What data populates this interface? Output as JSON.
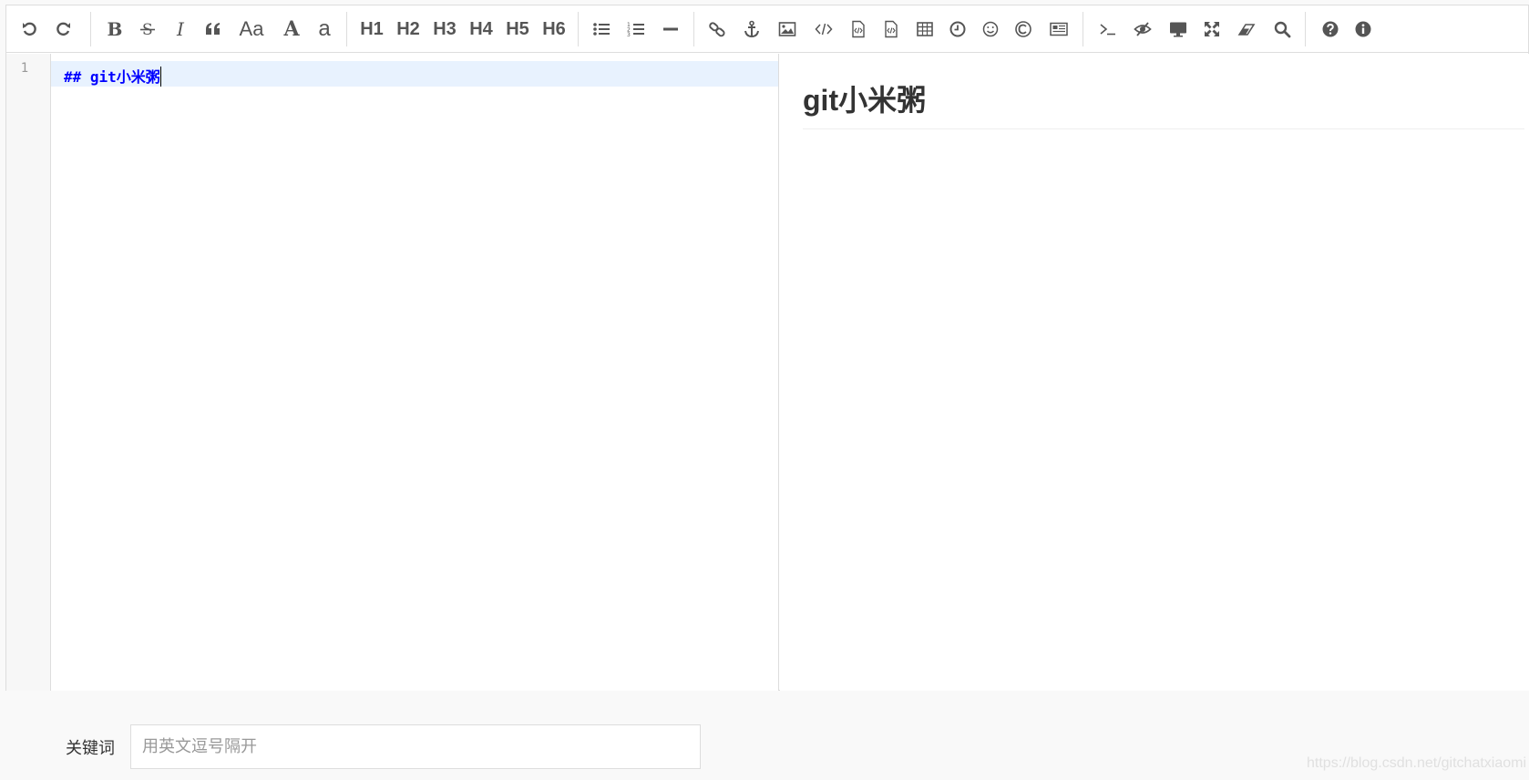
{
  "toolbar": {
    "h1": "H1",
    "h2": "H2",
    "h3": "H3",
    "h4": "H4",
    "h5": "H5",
    "h6": "H6",
    "bold": "B",
    "italic": "I",
    "aa": "Aa",
    "upper": "A",
    "lower": "a",
    "icons": [
      "undo-icon",
      "redo-icon",
      "bold-icon",
      "strikethrough-icon",
      "italic-icon",
      "quote-icon",
      "uppercase-first-icon",
      "uppercase-icon",
      "lowercase-icon",
      "h1",
      "h2",
      "h3",
      "h4",
      "h5",
      "h6",
      "unordered-list-icon",
      "ordered-list-icon",
      "horizontal-rule-icon",
      "link-icon",
      "anchor-icon",
      "image-icon",
      "code-icon",
      "preformatted-code-icon",
      "code-block-icon",
      "table-icon",
      "datetime-icon",
      "emoji-icon",
      "html-entities-icon",
      "pagebreak-icon",
      "terminal-icon",
      "unwatch-icon",
      "preview-icon",
      "fullscreen-icon",
      "clear-icon",
      "search-icon",
      "help-icon",
      "info-icon"
    ]
  },
  "editor": {
    "line_number": "1",
    "code_line": "## git小米粥"
  },
  "preview": {
    "heading": "git小米粥"
  },
  "keywords": {
    "label": "关键词",
    "placeholder": "用英文逗号隔开"
  },
  "watermark": "https://blog.csdn.net/gitchatxiaomi"
}
